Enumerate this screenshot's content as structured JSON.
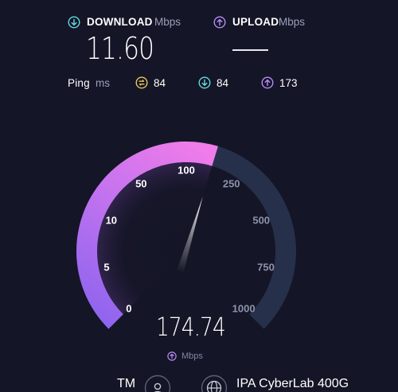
{
  "results": {
    "download": {
      "label": "DOWNLOAD",
      "unit": "Mbps",
      "value": "11.60",
      "icon": "download-arrow-icon",
      "color": "#62d9e0"
    },
    "upload": {
      "label": "UPLOAD",
      "unit": "Mbps",
      "value": "—",
      "icon": "upload-arrow-icon",
      "color": "#b58cf7"
    }
  },
  "ping": {
    "label": "Ping",
    "unit": "ms",
    "idle": {
      "value": "84",
      "icon": "jitter-icon",
      "color": "#e9c95a"
    },
    "download": {
      "value": "84",
      "icon": "download-arrow-icon",
      "color": "#62d9e0"
    },
    "upload": {
      "value": "173",
      "icon": "upload-arrow-icon",
      "color": "#b58cf7"
    }
  },
  "gauge": {
    "ticks": [
      "0",
      "5",
      "10",
      "50",
      "100",
      "250",
      "500",
      "750",
      "1000"
    ],
    "reading": "174.74",
    "reading_value": 174.74,
    "unit": "Mbps",
    "unit_icon": "upload-arrow-icon",
    "colors": {
      "active_start": "#8a63ee",
      "active_end": "#f07ce9",
      "track": "#26304b",
      "tick_active": "#ffffff",
      "tick_inactive": "#8d93ab"
    }
  },
  "footer": {
    "provider": "TM",
    "provider_icon": "user-icon",
    "server": "IPA CyberLab 400G",
    "server_icon": "globe-icon"
  }
}
